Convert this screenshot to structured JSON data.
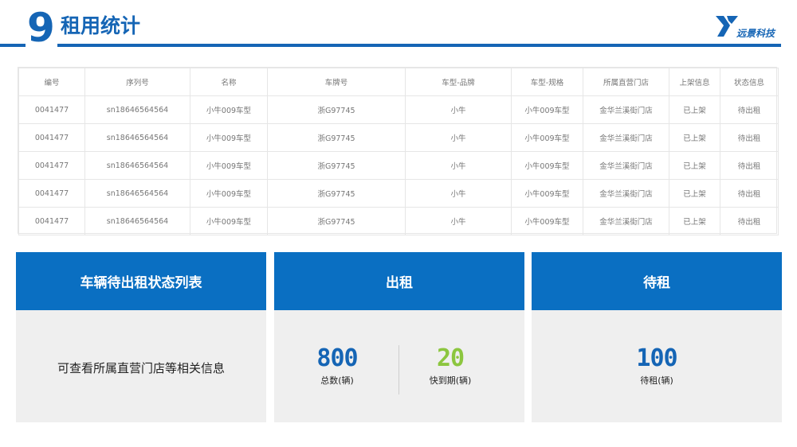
{
  "header": {
    "number": "9",
    "title": "租用统计",
    "logo_text": "远景科技"
  },
  "table": {
    "columns": [
      "编号",
      "序列号",
      "名称",
      "车牌号",
      "车型-品牌",
      "车型-规格",
      "所属直营门店",
      "上架信息",
      "状态信息"
    ],
    "rows": [
      [
        "0041477",
        "sn18646564564",
        "小牛009车型",
        "浙G97745",
        "小牛",
        "小牛009车型",
        "金华兰溪街门店",
        "已上架",
        "待出租"
      ],
      [
        "0041477",
        "sn18646564564",
        "小牛009车型",
        "浙G97745",
        "小牛",
        "小牛009车型",
        "金华兰溪街门店",
        "已上架",
        "待出租"
      ],
      [
        "0041477",
        "sn18646564564",
        "小牛009车型",
        "浙G97745",
        "小牛",
        "小牛009车型",
        "金华兰溪街门店",
        "已上架",
        "待出租"
      ],
      [
        "0041477",
        "sn18646564564",
        "小牛009车型",
        "浙G97745",
        "小牛",
        "小牛009车型",
        "金华兰溪街门店",
        "已上架",
        "待出租"
      ],
      [
        "0041477",
        "sn18646564564",
        "小牛009车型",
        "浙G97745",
        "小牛",
        "小牛009车型",
        "金华兰溪街门店",
        "已上架",
        "待出租"
      ]
    ]
  },
  "cards": {
    "list": {
      "title": "车辆待出租状态列表",
      "description": "可查看所属直营门店等相关信息"
    },
    "rent": {
      "title": "出租",
      "total_value": "800",
      "total_label": "总数(辆)",
      "expiring_value": "20",
      "expiring_label": "快到期(辆)"
    },
    "pending": {
      "title": "待租",
      "value": "100",
      "label": "待租(辆)"
    }
  },
  "colors": {
    "brand_blue": "#1565b5",
    "card_header_blue": "#0a6fc2",
    "stat_blue": "#1565b5",
    "stat_green": "#8cc63f"
  }
}
